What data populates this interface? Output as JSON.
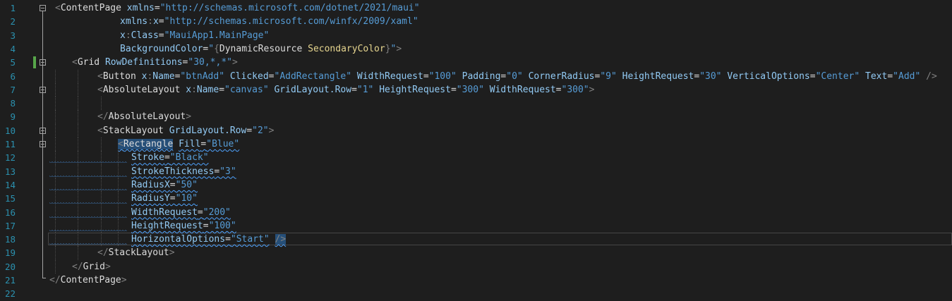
{
  "line_numbers": [
    "1",
    "2",
    "3",
    "4",
    "5",
    "6",
    "7",
    "8",
    "9",
    "10",
    "11",
    "12",
    "13",
    "14",
    "15",
    "16",
    "17",
    "18",
    "19",
    "20",
    "21",
    "22"
  ],
  "lines": [
    [
      {
        "t": "d",
        "v": "<"
      },
      {
        "t": "t",
        "v": "ContentPage"
      },
      {
        "t": "w",
        "v": " "
      },
      {
        "t": "a",
        "v": "xmlns"
      },
      {
        "t": "q",
        "v": "="
      },
      {
        "t": "s",
        "v": "\"http://schemas.microsoft.com/dotnet/2021/maui\""
      }
    ],
    [
      {
        "t": "a",
        "v": "xmlns"
      },
      {
        "t": "d",
        "v": ":"
      },
      {
        "t": "a",
        "v": "x"
      },
      {
        "t": "q",
        "v": "="
      },
      {
        "t": "s",
        "v": "\"http://schemas.microsoft.com/winfx/2009/xaml\""
      }
    ],
    [
      {
        "t": "a",
        "v": "x"
      },
      {
        "t": "d",
        "v": ":"
      },
      {
        "t": "a",
        "v": "Class"
      },
      {
        "t": "q",
        "v": "="
      },
      {
        "t": "s",
        "v": "\"MauiApp1.MainPage\""
      }
    ],
    [
      {
        "t": "a",
        "v": "BackgroundColor"
      },
      {
        "t": "q",
        "v": "="
      },
      {
        "t": "s",
        "v": "\""
      },
      {
        "t": "d",
        "v": "{"
      },
      {
        "t": "t",
        "v": "DynamicResource"
      },
      {
        "t": "w",
        "v": " "
      },
      {
        "t": "k",
        "v": "SecondaryColor"
      },
      {
        "t": "d",
        "v": "}"
      },
      {
        "t": "s",
        "v": "\""
      },
      {
        "t": "d",
        "v": ">"
      }
    ],
    [
      {
        "t": "d",
        "v": "<"
      },
      {
        "t": "t",
        "v": "Grid"
      },
      {
        "t": "w",
        "v": " "
      },
      {
        "t": "a",
        "v": "RowDefinitions"
      },
      {
        "t": "q",
        "v": "="
      },
      {
        "t": "s",
        "v": "\"30,*,*\""
      },
      {
        "t": "d",
        "v": ">"
      }
    ],
    [
      {
        "t": "d",
        "v": "<"
      },
      {
        "t": "t",
        "v": "Button"
      },
      {
        "t": "w",
        "v": " "
      },
      {
        "t": "a",
        "v": "x"
      },
      {
        "t": "d",
        "v": ":"
      },
      {
        "t": "a",
        "v": "Name"
      },
      {
        "t": "q",
        "v": "="
      },
      {
        "t": "s",
        "v": "\"btnAdd\""
      },
      {
        "t": "w",
        "v": " "
      },
      {
        "t": "a",
        "v": "Clicked"
      },
      {
        "t": "q",
        "v": "="
      },
      {
        "t": "s",
        "v": "\"AddRectangle\""
      },
      {
        "t": "w",
        "v": " "
      },
      {
        "t": "a",
        "v": "WidthRequest"
      },
      {
        "t": "q",
        "v": "="
      },
      {
        "t": "s",
        "v": "\"100\""
      },
      {
        "t": "w",
        "v": " "
      },
      {
        "t": "a",
        "v": "Padding"
      },
      {
        "t": "q",
        "v": "="
      },
      {
        "t": "s",
        "v": "\"0\""
      },
      {
        "t": "w",
        "v": " "
      },
      {
        "t": "a",
        "v": "CornerRadius"
      },
      {
        "t": "q",
        "v": "="
      },
      {
        "t": "s",
        "v": "\"9\""
      },
      {
        "t": "w",
        "v": " "
      },
      {
        "t": "a",
        "v": "HeightRequest"
      },
      {
        "t": "q",
        "v": "="
      },
      {
        "t": "s",
        "v": "\"30\""
      },
      {
        "t": "w",
        "v": " "
      },
      {
        "t": "a",
        "v": "VerticalOptions"
      },
      {
        "t": "q",
        "v": "="
      },
      {
        "t": "s",
        "v": "\"Center\""
      },
      {
        "t": "w",
        "v": " "
      },
      {
        "t": "a",
        "v": "Text"
      },
      {
        "t": "q",
        "v": "="
      },
      {
        "t": "s",
        "v": "\"Add\""
      },
      {
        "t": "w",
        "v": " "
      },
      {
        "t": "d",
        "v": "/>"
      }
    ],
    [
      {
        "t": "d",
        "v": "<"
      },
      {
        "t": "t",
        "v": "AbsoluteLayout"
      },
      {
        "t": "w",
        "v": " "
      },
      {
        "t": "a",
        "v": "x"
      },
      {
        "t": "d",
        "v": ":"
      },
      {
        "t": "a",
        "v": "Name"
      },
      {
        "t": "q",
        "v": "="
      },
      {
        "t": "s",
        "v": "\"canvas\""
      },
      {
        "t": "w",
        "v": " "
      },
      {
        "t": "a",
        "v": "GridLayout.Row"
      },
      {
        "t": "q",
        "v": "="
      },
      {
        "t": "s",
        "v": "\"1\""
      },
      {
        "t": "w",
        "v": " "
      },
      {
        "t": "a",
        "v": "HeightRequest"
      },
      {
        "t": "q",
        "v": "="
      },
      {
        "t": "s",
        "v": "\"300\""
      },
      {
        "t": "w",
        "v": " "
      },
      {
        "t": "a",
        "v": "WidthRequest"
      },
      {
        "t": "q",
        "v": "="
      },
      {
        "t": "s",
        "v": "\"300\""
      },
      {
        "t": "d",
        "v": ">"
      }
    ],
    [],
    [
      {
        "t": "d",
        "v": "</"
      },
      {
        "t": "t",
        "v": "AbsoluteLayout"
      },
      {
        "t": "d",
        "v": ">"
      }
    ],
    [
      {
        "t": "d",
        "v": "<"
      },
      {
        "t": "t",
        "v": "StackLayout"
      },
      {
        "t": "w",
        "v": " "
      },
      {
        "t": "a",
        "v": "GridLayout.Row"
      },
      {
        "t": "q",
        "v": "="
      },
      {
        "t": "s",
        "v": "\"2\""
      },
      {
        "t": "d",
        "v": ">"
      }
    ],
    [
      {
        "t": "d",
        "v": "<",
        "sel": true
      },
      {
        "t": "t",
        "v": "Rectangle",
        "sel": true
      },
      {
        "t": "w",
        "v": " "
      },
      {
        "t": "a",
        "v": "Fill"
      },
      {
        "t": "q",
        "v": "="
      },
      {
        "t": "s",
        "v": "\"Blue\""
      }
    ],
    [
      {
        "t": "a",
        "v": "Stroke"
      },
      {
        "t": "q",
        "v": "="
      },
      {
        "t": "s",
        "v": "\"Black\""
      }
    ],
    [
      {
        "t": "a",
        "v": "StrokeThickness"
      },
      {
        "t": "q",
        "v": "="
      },
      {
        "t": "s",
        "v": "\"3\""
      }
    ],
    [
      {
        "t": "a",
        "v": "RadiusX"
      },
      {
        "t": "q",
        "v": "="
      },
      {
        "t": "s",
        "v": "\"50\""
      }
    ],
    [
      {
        "t": "a",
        "v": "RadiusY"
      },
      {
        "t": "q",
        "v": "="
      },
      {
        "t": "s",
        "v": "\"10\""
      }
    ],
    [
      {
        "t": "a",
        "v": "WidthRequest"
      },
      {
        "t": "q",
        "v": "="
      },
      {
        "t": "s",
        "v": "\"200\""
      }
    ],
    [
      {
        "t": "a",
        "v": "HeightRequest"
      },
      {
        "t": "q",
        "v": "="
      },
      {
        "t": "s",
        "v": "\"100\""
      }
    ],
    [
      {
        "t": "a",
        "v": "HorizontalOptions"
      },
      {
        "t": "q",
        "v": "="
      },
      {
        "t": "s",
        "v": "\"Start\""
      },
      {
        "t": "w",
        "v": " "
      },
      {
        "t": "d",
        "v": "/>",
        "sel": true
      }
    ],
    [
      {
        "t": "d",
        "v": "</"
      },
      {
        "t": "t",
        "v": "StackLayout"
      },
      {
        "t": "d",
        "v": ">"
      }
    ],
    [
      {
        "t": "d",
        "v": "</"
      },
      {
        "t": "t",
        "v": "Grid"
      },
      {
        "t": "d",
        "v": ">"
      }
    ],
    [
      {
        "t": "d",
        "v": "</"
      },
      {
        "t": "t",
        "v": "ContentPage"
      },
      {
        "t": "d",
        "v": ">"
      }
    ],
    []
  ],
  "colors": {
    "background": "#1e1e1e",
    "line_number": "#2b91af",
    "tag": "#dcdcdc",
    "attribute": "#92caf4",
    "string": "#569cd6",
    "delimiter": "#808080",
    "resource_key": "#e6d58f",
    "change_bar": "#57a64a",
    "selection": "#264f78",
    "squiggle": "#4fa3ff"
  },
  "squiggled_lines": [
    12,
    13,
    14,
    15,
    16,
    17,
    18
  ],
  "changed_lines": [
    5,
    6,
    7,
    8,
    9,
    10,
    11,
    12,
    13,
    14,
    15,
    16,
    17,
    18,
    19
  ],
  "current_line": 18,
  "fold_markers": [
    1,
    5,
    7,
    10,
    11
  ]
}
